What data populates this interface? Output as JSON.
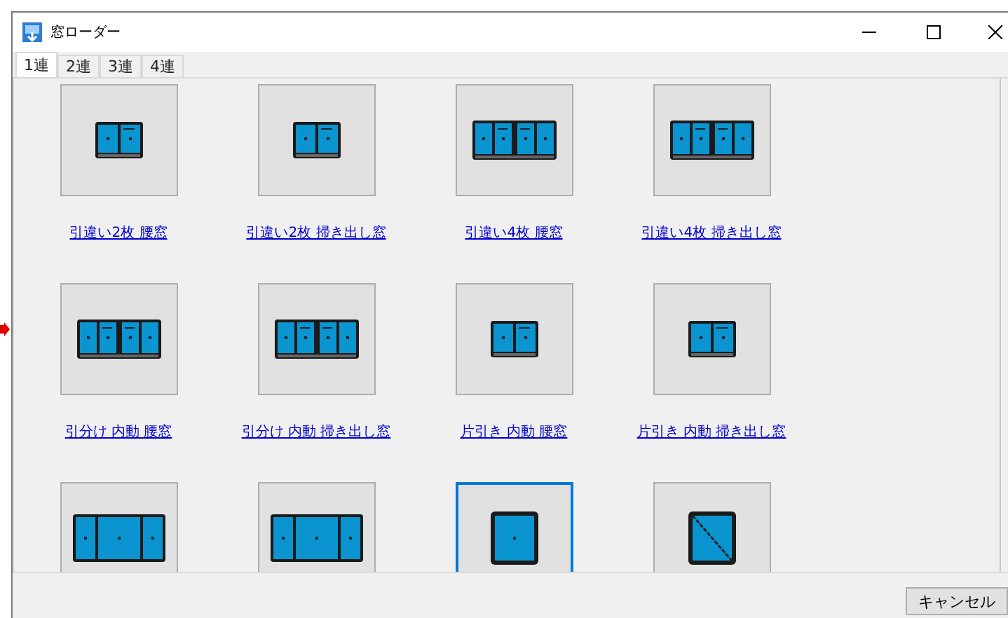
{
  "window": {
    "title": "窓ローダー"
  },
  "tabs": [
    {
      "label": "1連",
      "selected": true
    },
    {
      "label": "2連",
      "selected": false
    },
    {
      "label": "3連",
      "selected": false
    },
    {
      "label": "4連",
      "selected": false
    }
  ],
  "items": [
    {
      "label": "引違い2枚 腰窓",
      "kind": "sash2",
      "selected": false
    },
    {
      "label": "引違い2枚 掃き出し窓",
      "kind": "sash2",
      "selected": false
    },
    {
      "label": "引違い4枚 腰窓",
      "kind": "sash4",
      "selected": false
    },
    {
      "label": "引違い4枚 掃き出し窓",
      "kind": "sash4",
      "selected": false
    },
    {
      "label": "引分け 内動 腰窓",
      "kind": "sash4",
      "selected": false
    },
    {
      "label": "引分け 内動 掃き出し窓",
      "kind": "sash4",
      "selected": false
    },
    {
      "label": "片引き 内動 腰窓",
      "kind": "sash2",
      "selected": false
    },
    {
      "label": "片引き 内動 掃き出し窓",
      "kind": "sash2",
      "selected": false
    },
    {
      "kind": "fix3",
      "selected": false
    },
    {
      "kind": "fix3",
      "selected": false
    },
    {
      "kind": "fixed",
      "selected": true
    },
    {
      "kind": "casement",
      "selected": false
    }
  ],
  "buttons": [
    {
      "label": "キャンセル"
    }
  ]
}
